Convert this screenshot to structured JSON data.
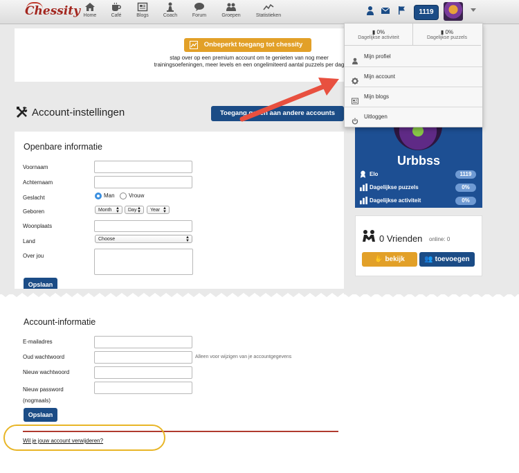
{
  "app": {
    "logo_text": "Chessity"
  },
  "nav": {
    "items": [
      {
        "label": "Home",
        "icon": "home-icon"
      },
      {
        "label": "Café",
        "icon": "coffee-icon"
      },
      {
        "label": "Blogs",
        "icon": "newspaper-icon"
      },
      {
        "label": "Coach",
        "icon": "chess-pawn-icon"
      },
      {
        "label": "Forum",
        "icon": "speech-bubble-icon"
      },
      {
        "label": "Groepen",
        "icon": "group-icon"
      },
      {
        "label": "Statistieken",
        "icon": "line-chart-icon"
      }
    ],
    "user_elo": "1119"
  },
  "dropdown": {
    "stats": [
      {
        "value": "0%",
        "label": "Dagelijkse activiteit"
      },
      {
        "value": "0%",
        "label": "Dagelijkse puzzels"
      }
    ],
    "items": [
      {
        "label": "Mijn profiel",
        "icon": "user-icon"
      },
      {
        "label": "Mijn account",
        "icon": "gear-icon"
      },
      {
        "label": "Mijn blogs",
        "icon": "newspaper-icon"
      },
      {
        "label": "Uitloggen",
        "icon": "power-icon"
      }
    ]
  },
  "promo": {
    "button_label": "Onbeperkt toegang tot chessity",
    "text": "stap over op een premium account om te genieten van nog meer trainingsoefeningen, meer levels en een ongelimiteerd aantal puzzels per dag"
  },
  "settings": {
    "title": "Account-instellingen",
    "access_button": "Toegang geven aan andere accounts"
  },
  "public_info": {
    "title": "Openbare informatie",
    "fields": {
      "first_name": "Voornaam",
      "last_name": "Achternaam",
      "gender": "Geslacht",
      "born": "Geboren",
      "residence": "Woonplaats",
      "country": "Land",
      "about": "Over jou"
    },
    "gender_options": [
      "Man",
      "Vrouw"
    ],
    "gender_selected": "Man",
    "birth_selects": [
      "Month",
      "Day",
      "Year"
    ],
    "country_value": "Choose",
    "save_label": "Opslaan"
  },
  "account_info": {
    "title": "Account-informatie",
    "fields": {
      "email": "E-mailadres",
      "old_password": "Oud wachtwoord",
      "new_password": "Nieuw wachtwoord",
      "new_password_again_1": "Nieuw password",
      "new_password_again_2": "(nogmaals)"
    },
    "old_password_hint": "Alleen voor wijzigen van je accountgegevens",
    "save_label": "Opslaan",
    "delete_link": "Wil je jouw account verwijderen?"
  },
  "profile": {
    "username": "Urbbss",
    "stats": [
      {
        "label": "Elo",
        "value": "1119",
        "icon": "award-icon"
      },
      {
        "label": "Dagelijkse puzzels",
        "value": "0%",
        "icon": "bar-chart-icon"
      },
      {
        "label": "Dagelijkse activiteit",
        "value": "0%",
        "icon": "bar-chart-icon"
      }
    ]
  },
  "friends": {
    "count": "0",
    "label": "Vrienden",
    "online_label": "online:",
    "online_count": "0",
    "view_button": "bekijk",
    "add_button": "toevoegen"
  },
  "colors": {
    "brand_blue": "#1b4c86",
    "accent_orange": "#e2a028",
    "annotation_red": "#e8503f",
    "highlight_yellow": "#e8b526"
  }
}
